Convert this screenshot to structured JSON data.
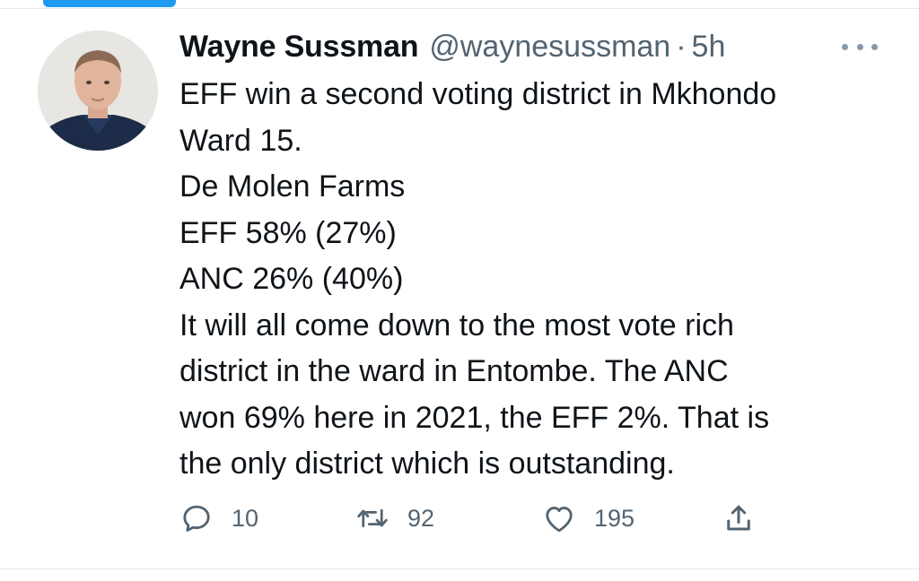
{
  "tweet": {
    "author_name": "Wayne Sussman",
    "author_handle": "@waynesussman",
    "separator": "·",
    "time": "5h",
    "lines": [
      "EFF win a second voting district in Mkhondo",
      "Ward 15.",
      "De Molen Farms",
      "EFF 58% (27%)",
      "ANC 26% (40%)",
      "It will all come down to the most vote rich",
      "district in the ward in Entombe. The ANC",
      "won 69% here in 2021, the EFF 2%. That is",
      "the only district which is outstanding."
    ]
  },
  "actions": {
    "reply_count": "10",
    "retweet_count": "92",
    "like_count": "195"
  },
  "icons": {
    "reply": "reply-icon",
    "retweet": "retweet-icon",
    "like": "heart-icon",
    "share": "share-icon",
    "more": "more-icon"
  },
  "colors": {
    "accent": "#1d9bf0",
    "text": "#0f1419",
    "secondary": "#536471"
  }
}
